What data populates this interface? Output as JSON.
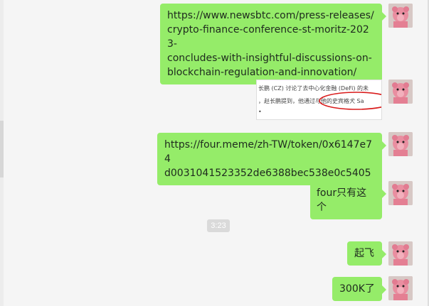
{
  "messages": [
    {
      "type": "text",
      "text": "https://www.newsbtc.com/press-releases/\ncrypto-finance-conference-st-moritz-2023-\nconcludes-with-insightful-discussions-on-\nblockchain-regulation-and-innovation/"
    },
    {
      "type": "image",
      "text_line1": "长鹏 (CZ) 讨论了去中心化金融 (DeFi) 的未",
      "text_line2": "，赵长鹏提到，他通过与他的史宾格犬 Sa",
      "text_line3": "•"
    },
    {
      "type": "text",
      "text": "https://four.meme/zh-TW/token/0x6147e74\nd0031041523352de6388bec538e0c5405"
    },
    {
      "type": "text",
      "text": "four只有这个"
    },
    {
      "type": "time",
      "text": "3:23"
    },
    {
      "type": "text",
      "text": "起飞"
    },
    {
      "type": "text",
      "text": "300K了"
    }
  ],
  "colors": {
    "bubble": "#95ec69",
    "background": "#f5f5f5",
    "avatar": "#e79aa8"
  }
}
